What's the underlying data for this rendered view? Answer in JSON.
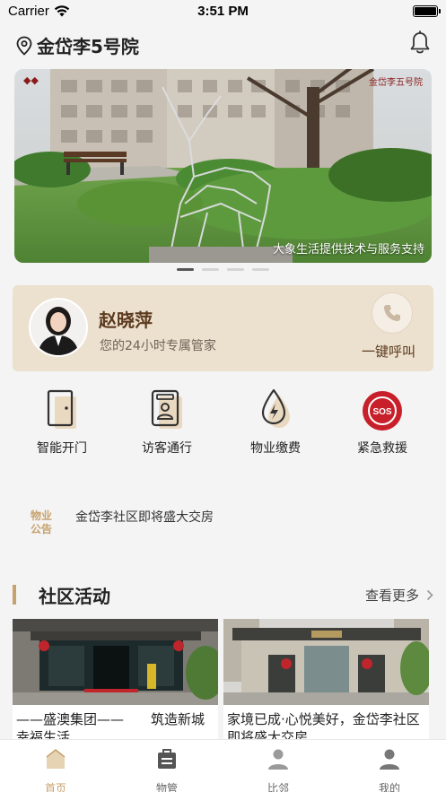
{
  "status_bar": {
    "carrier": "Carrier",
    "time": "3:51 PM"
  },
  "header": {
    "location": "金岱李5号院"
  },
  "banner": {
    "caption": "大象生活提供技术与服务支持",
    "logo_right": "金岱李五号院",
    "slides": 4,
    "active_slide": 1
  },
  "manager": {
    "name": "赵晓萍",
    "description": "您的24小时专属管家",
    "call_label": "一键呼叫"
  },
  "actions": [
    {
      "label": "智能开门",
      "icon": "door-icon"
    },
    {
      "label": "访客通行",
      "icon": "visitor-pass-icon"
    },
    {
      "label": "物业缴费",
      "icon": "property-payment-icon"
    },
    {
      "label": "紧急救援",
      "icon": "sos-icon",
      "icon_text": "SOS"
    }
  ],
  "notice": {
    "tag": "物业公告",
    "text": "金岱李社区即将盛大交房"
  },
  "activities": {
    "title": "社区活动",
    "more_label": "查看更多",
    "cards": [
      {
        "title": "——盛澳集团——　　筑造新城幸福生活"
      },
      {
        "title": "家境已成·心悦美好，金岱李社区即将盛大交房"
      }
    ]
  },
  "tabbar": {
    "items": [
      {
        "label": "首页",
        "icon": "home-icon",
        "active": true
      },
      {
        "label": "物管",
        "icon": "property-management-icon",
        "active": false
      },
      {
        "label": "比邻",
        "icon": "neighbor-icon",
        "active": false
      },
      {
        "label": "我的",
        "icon": "profile-icon",
        "active": false
      }
    ]
  },
  "colors": {
    "accent": "#c7a26e",
    "card_bg": "#ece0cf",
    "sos_red": "#c8202a"
  }
}
